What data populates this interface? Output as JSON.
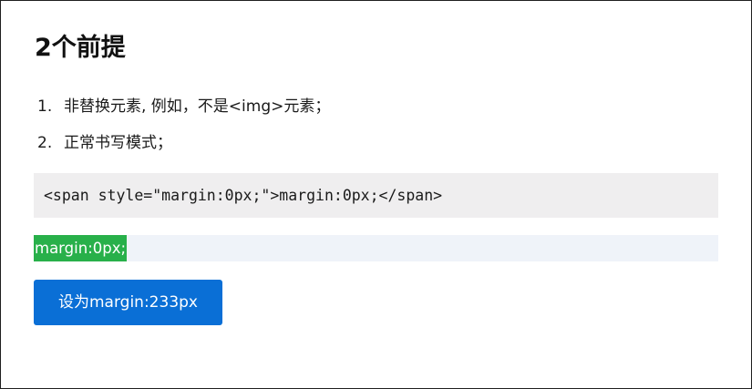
{
  "page": {
    "title": "2个前提"
  },
  "requirements": [
    {
      "number": "1.",
      "text": "非替换元素, 例如，不是<img>元素；"
    },
    {
      "number": "2.",
      "text": "正常书写模式；"
    }
  ],
  "code_sample": {
    "text": "<span style=\"margin:0px;\">margin:0px;</span>"
  },
  "demo": {
    "span_text": "margin:0px;",
    "highlight_color": "#28b04a",
    "box_color": "#eff3f9"
  },
  "action_button": {
    "label": "设为margin:233px",
    "color": "#0a6fd6"
  }
}
